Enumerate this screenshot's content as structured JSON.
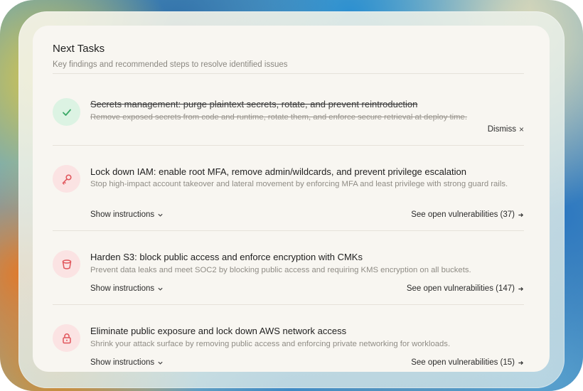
{
  "panel": {
    "title": "Next Tasks",
    "subtitle": "Key findings and recommended steps to resolve identified issues"
  },
  "tasks": [
    {
      "title": "Secrets management: purge plaintext secrets, rotate, and prevent reintroduction",
      "description": "Remove exposed secrets from code and runtime, rotate them, and enforce secure retrieval at deploy time.",
      "status": "completed",
      "icon": "check-icon",
      "dismiss_label": "Dismiss",
      "dismiss_icon": "×"
    },
    {
      "title": "Lock down IAM: enable root MFA, remove admin/wildcards, and prevent privilege escalation",
      "description": "Stop high-impact account takeover and lateral movement by enforcing MFA and least privilege with strong guard rails.",
      "status": "open",
      "icon": "key-icon",
      "instructions_label": "Show instructions",
      "vulns_label": "See open vulnerabilities (37)"
    },
    {
      "title": "Harden S3: block public access and enforce encryption with CMKs",
      "description": "Prevent data leaks and meet SOC2 by blocking public access and requiring KMS encryption on all buckets.",
      "status": "open",
      "icon": "bucket-icon",
      "instructions_label": "Show instructions",
      "vulns_label": "See open vulnerabilities (147)"
    },
    {
      "title": "Eliminate public exposure and lock down AWS network access",
      "description": "Shrink your attack surface by removing public access and enforcing private networking for workloads.",
      "status": "open",
      "icon": "lock-icon",
      "instructions_label": "Show instructions",
      "vulns_label": "See open vulnerabilities (15)"
    }
  ],
  "colors": {
    "done_bg": "#dcf3e3",
    "done_fg": "#3aa866",
    "todo_bg": "#fbe3e3",
    "todo_fg": "#e0555b"
  }
}
